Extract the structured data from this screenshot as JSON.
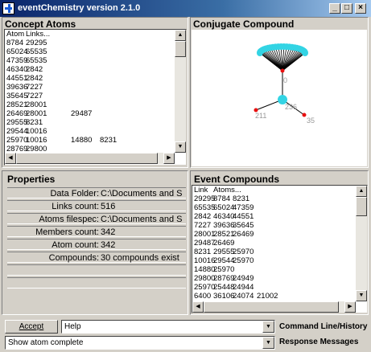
{
  "window": {
    "title": "eventChemistry  version 2.1.0",
    "minimize": "_",
    "maximize": "□",
    "close": "×"
  },
  "concept_atoms": {
    "title": "Concept Atoms",
    "header": [
      "Atom",
      "Links..."
    ],
    "rows": [
      [
        "8784",
        "29295",
        "",
        ""
      ],
      [
        "65024",
        "65535",
        "",
        ""
      ],
      [
        "47359",
        "65535",
        "",
        ""
      ],
      [
        "46340",
        "2842",
        "",
        ""
      ],
      [
        "44551",
        "2842",
        "",
        ""
      ],
      [
        "39636",
        "7227",
        "",
        ""
      ],
      [
        "35645",
        "7227",
        "",
        ""
      ],
      [
        "28521",
        "28001",
        "",
        ""
      ],
      [
        "26469",
        "28001",
        "29487",
        ""
      ],
      [
        "29555",
        "8231",
        "",
        ""
      ],
      [
        "29544",
        "10016",
        "",
        ""
      ],
      [
        "25970",
        "10016",
        "14880",
        "8231"
      ],
      [
        "28769",
        "29800",
        "",
        ""
      ]
    ]
  },
  "conjugate_compound": {
    "title": "Conjugate Compound",
    "labels": [
      "0",
      "211",
      "236",
      "35"
    ],
    "colors": {
      "fan": "#33d4e4",
      "node": "#33d4e4",
      "atom": "#e81010",
      "bond": "#000000"
    }
  },
  "properties": {
    "title": "Properties",
    "rows": [
      {
        "label": "Data Folder:",
        "value": "C:\\Documents and S"
      },
      {
        "label": "Links count:",
        "value": "516"
      },
      {
        "label": "Atoms filespec:",
        "value": "C:\\Documents and S"
      },
      {
        "label": "Members count:",
        "value": "342"
      },
      {
        "label": "Atom count:",
        "value": "342"
      },
      {
        "label": "Compounds:",
        "value": "30 compounds exist"
      },
      {
        "label": "",
        "value": ""
      },
      {
        "label": "",
        "value": ""
      }
    ]
  },
  "event_compounds": {
    "title": "Event Compounds",
    "header": [
      "Link",
      "Atoms..."
    ],
    "rows": [
      [
        "29295",
        "8784",
        "8231",
        ""
      ],
      [
        "65535",
        "65024",
        "47359",
        ""
      ],
      [
        "2842",
        "46340",
        "44551",
        ""
      ],
      [
        "7227",
        "39636",
        "35645",
        ""
      ],
      [
        "28001",
        "28521",
        "26469",
        ""
      ],
      [
        "29487",
        "26469",
        "",
        ""
      ],
      [
        "8231",
        "29555",
        "25970",
        ""
      ],
      [
        "10016",
        "29544",
        "25970",
        ""
      ],
      [
        "14880",
        "25970",
        "",
        ""
      ],
      [
        "29800",
        "28769",
        "24949",
        ""
      ],
      [
        "25970",
        "25448",
        "24944",
        ""
      ],
      [
        "6400",
        "36106",
        "24074",
        "21002"
      ]
    ]
  },
  "command": {
    "accept_label": "Accept",
    "input_value": "Help",
    "caption": "Command Line/History"
  },
  "response": {
    "value": "Show atom complete",
    "caption": "Response Messages"
  },
  "scroll_glyphs": {
    "up": "▲",
    "down": "▼",
    "left": "◀",
    "right": "▶"
  }
}
